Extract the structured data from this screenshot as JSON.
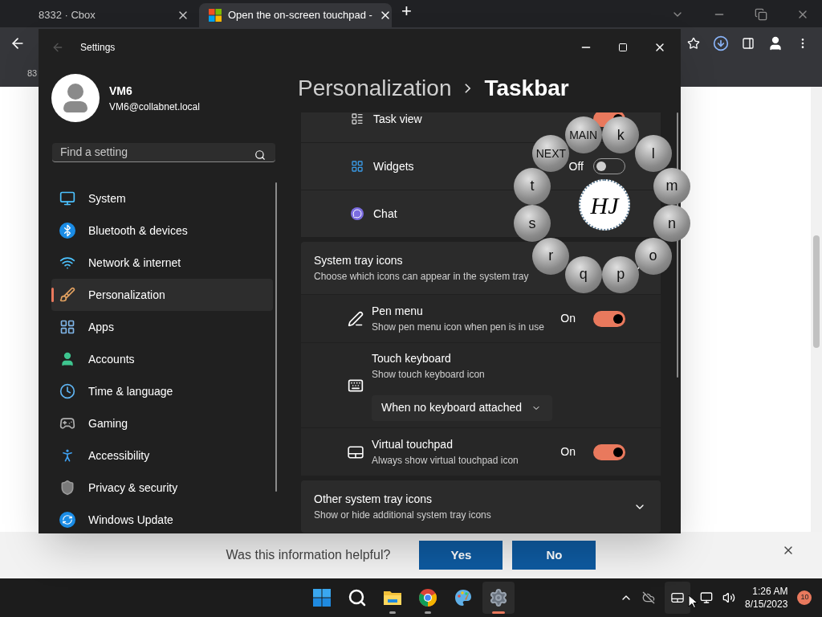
{
  "browser": {
    "tabs": [
      {
        "title": "8332 · Cbox",
        "selected": false
      },
      {
        "title": "Open the on-screen touchpad -",
        "selected": true
      }
    ],
    "new_tab": "+",
    "bookmark": "83"
  },
  "settings": {
    "title": "Settings",
    "user": {
      "name": "VM6",
      "email": "VM6@collabnet.local"
    },
    "search": {
      "placeholder": "Find a setting"
    },
    "nav": [
      {
        "label": "System",
        "selected": false
      },
      {
        "label": "Bluetooth & devices",
        "selected": false
      },
      {
        "label": "Network & internet",
        "selected": false
      },
      {
        "label": "Personalization",
        "selected": true
      },
      {
        "label": "Apps",
        "selected": false
      },
      {
        "label": "Accounts",
        "selected": false
      },
      {
        "label": "Time & language",
        "selected": false
      },
      {
        "label": "Gaming",
        "selected": false
      },
      {
        "label": "Accessibility",
        "selected": false
      },
      {
        "label": "Privacy & security",
        "selected": false
      },
      {
        "label": "Windows Update",
        "selected": false
      }
    ],
    "breadcrumb": [
      "Personalization",
      "Taskbar"
    ],
    "taskbar_items": [
      {
        "label": "Task view",
        "on": true
      },
      {
        "label": "Widgets",
        "state": "Off",
        "on": false
      },
      {
        "label": "Chat"
      }
    ],
    "tray_section": {
      "title": "System tray icons",
      "subtitle": "Choose which icons can appear in the system tray",
      "expanded": true,
      "items": [
        {
          "kind": "toggle",
          "label": "Pen menu",
          "subtitle": "Show pen menu icon when pen is in use",
          "state": "On",
          "on": true
        },
        {
          "kind": "dropdown",
          "label": "Touch keyboard",
          "subtitle": "Show touch keyboard icon",
          "value": "When no keyboard attached"
        },
        {
          "kind": "toggle",
          "label": "Virtual touchpad",
          "subtitle": "Always show virtual touchpad icon",
          "state": "On",
          "on": true
        }
      ]
    },
    "other_section": {
      "title": "Other system tray icons",
      "subtitle": "Show or hide additional system tray icons",
      "expanded": false
    }
  },
  "keyboard_overlay": {
    "keys": [
      "MAIN",
      "k",
      "l",
      "m",
      "n",
      "o",
      "p",
      "q",
      "r",
      "s",
      "t",
      "NEXT"
    ],
    "center": "HJ"
  },
  "feedback": {
    "question": "Was this information helpful?",
    "buttons": [
      "Yes",
      "No"
    ]
  },
  "taskbar": {
    "apps": [
      {
        "running": false,
        "active": false
      },
      {
        "running": false,
        "active": false
      },
      {
        "running": true,
        "active": false
      },
      {
        "running": true,
        "active": false
      },
      {
        "running": false,
        "active": false
      },
      {
        "running": true,
        "active": true
      }
    ],
    "time": "1:26 AM",
    "date": "8/15/2023",
    "notifications": "10"
  }
}
